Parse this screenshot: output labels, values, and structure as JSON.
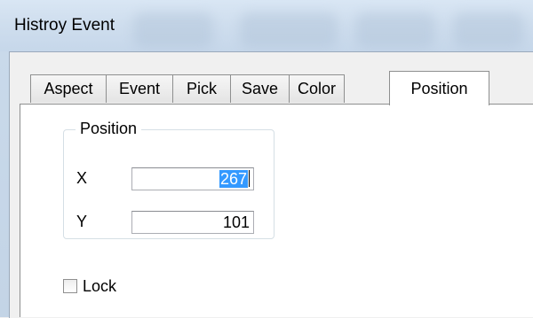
{
  "window": {
    "title": "Histroy Event"
  },
  "tabs": [
    {
      "label": "Aspect"
    },
    {
      "label": "Event"
    },
    {
      "label": "Pick"
    },
    {
      "label": "Save"
    },
    {
      "label": "Color"
    },
    {
      "label": "Position"
    }
  ],
  "active_tab": "Position",
  "position_group": {
    "legend": "Position",
    "x_label": "X",
    "x_value": "267",
    "y_label": "Y",
    "y_value": "101"
  },
  "lock": {
    "label": "Lock",
    "checked": false
  },
  "colors": {
    "selection": "#3399ff",
    "title_bar": "#d9e6f4"
  }
}
